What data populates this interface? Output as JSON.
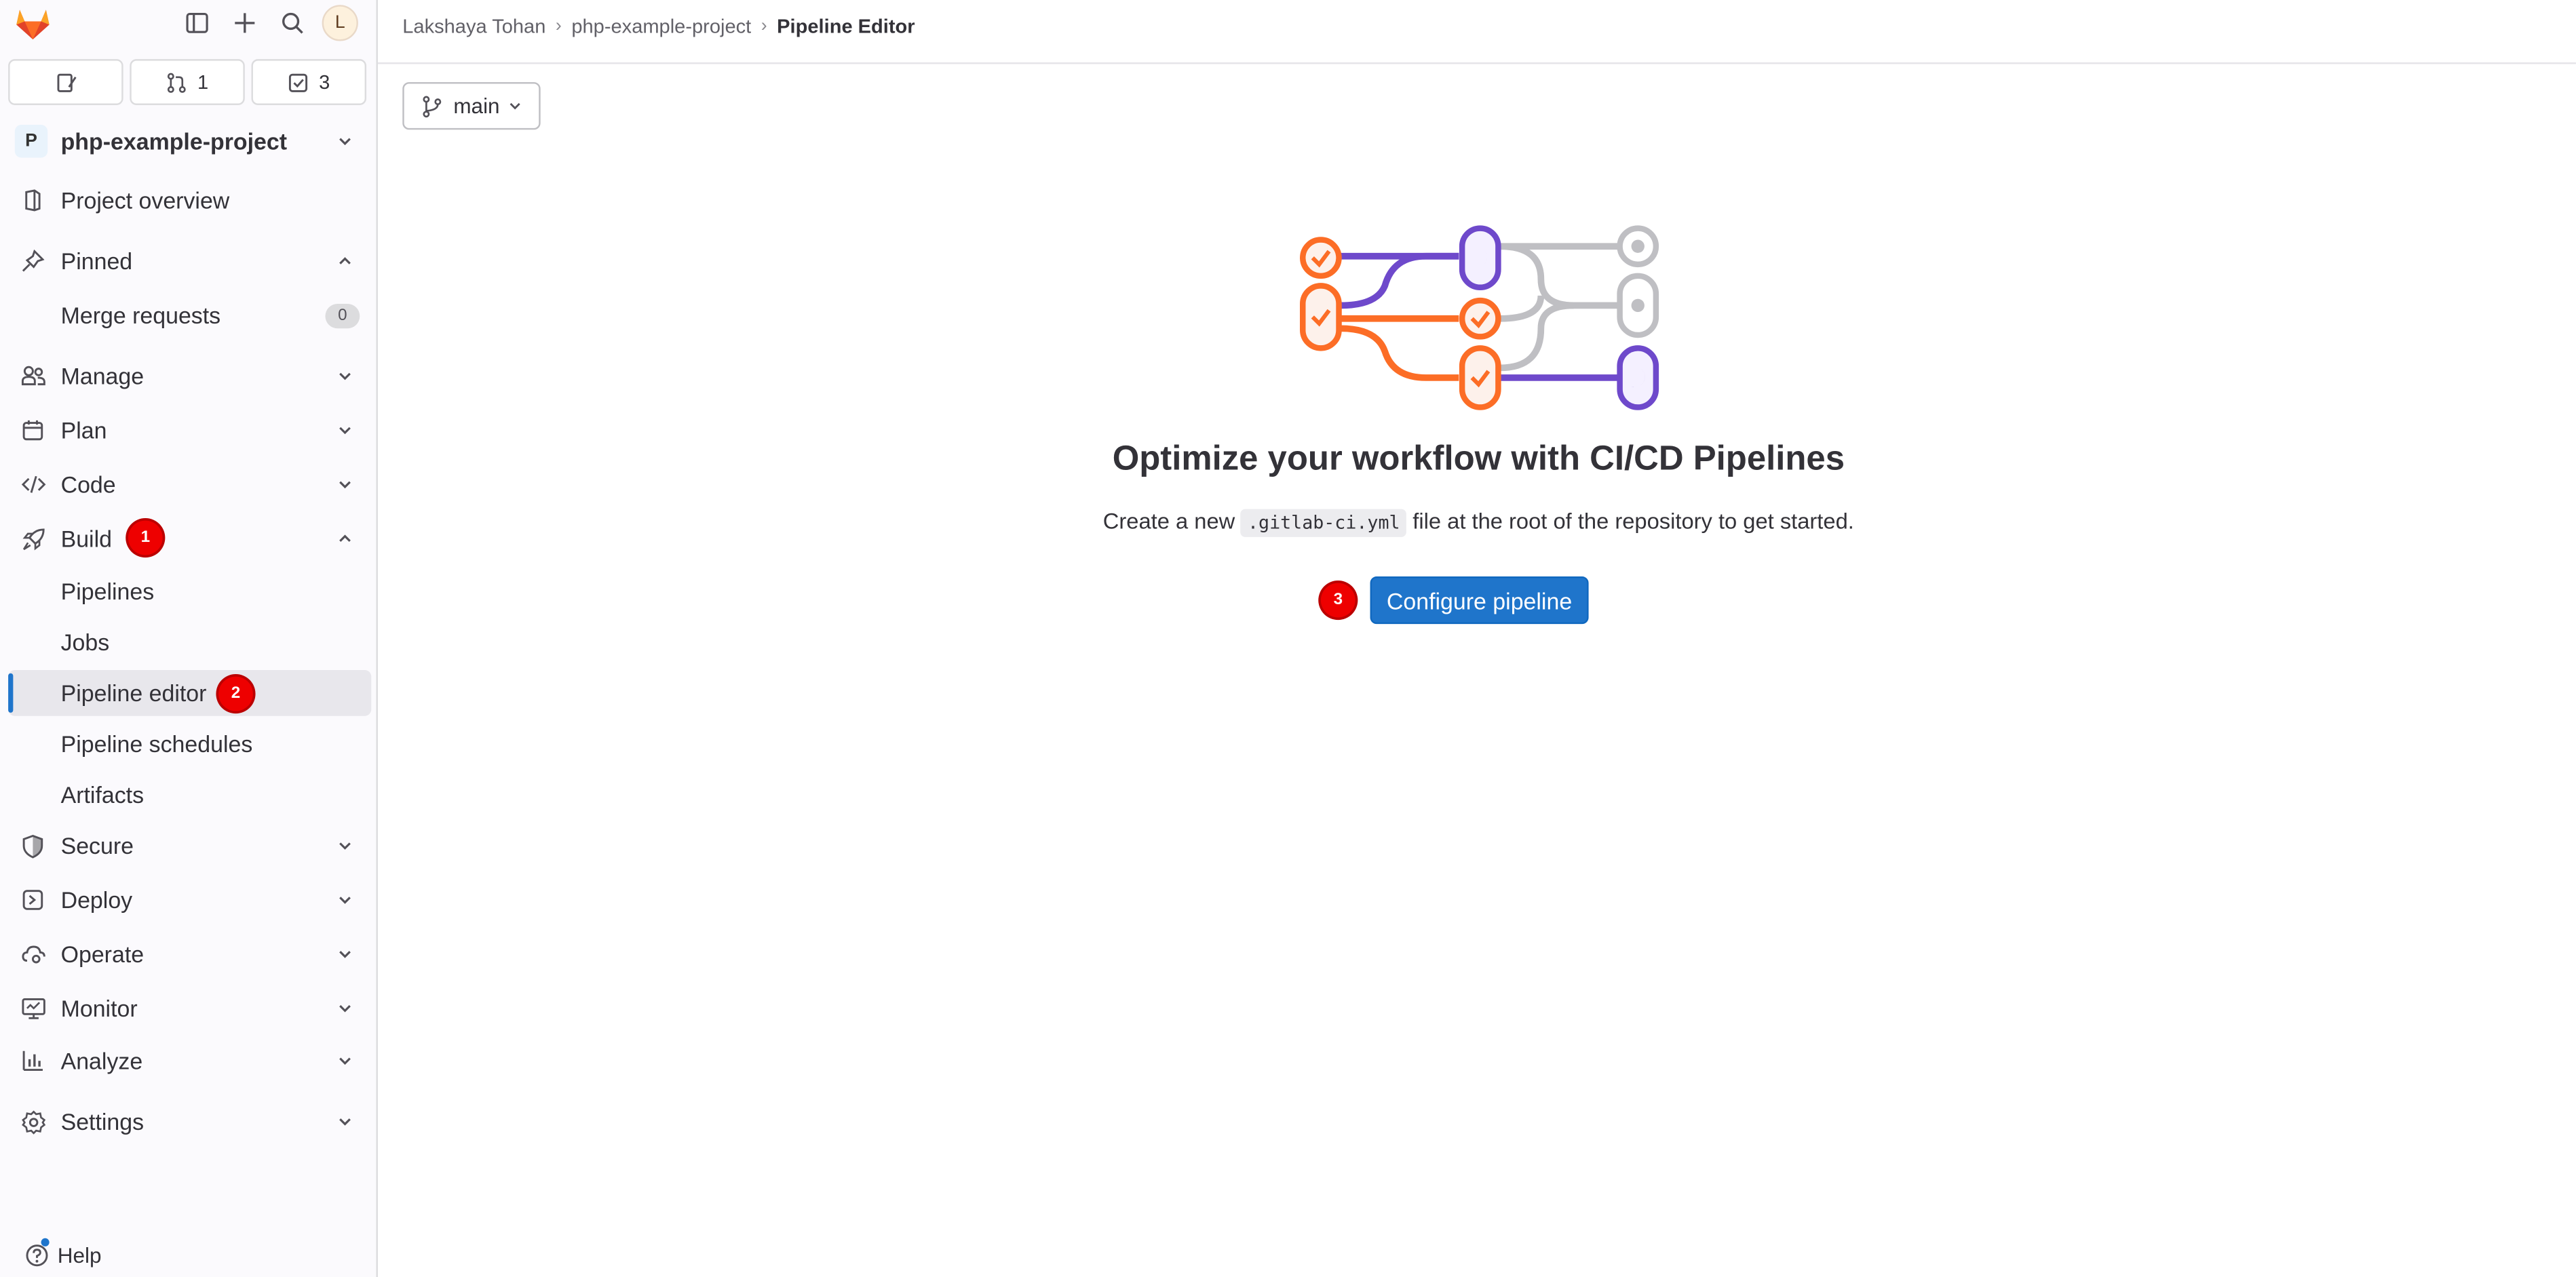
{
  "topbar": {
    "avatar_initial": "L"
  },
  "counts": {
    "merge_requests": "1",
    "todos": "3"
  },
  "project": {
    "initial": "P",
    "name": "php-example-project"
  },
  "nav": {
    "project_overview": "Project overview",
    "pinned": "Pinned",
    "merge_requests": "Merge requests",
    "merge_requests_count": "0",
    "manage": "Manage",
    "plan": "Plan",
    "code": "Code",
    "build": "Build",
    "build_children": {
      "pipelines": "Pipelines",
      "jobs": "Jobs",
      "pipeline_editor": "Pipeline editor",
      "pipeline_schedules": "Pipeline schedules",
      "artifacts": "Artifacts"
    },
    "secure": "Secure",
    "deploy": "Deploy",
    "operate": "Operate",
    "monitor": "Monitor",
    "analyze": "Analyze",
    "settings": "Settings"
  },
  "help": "Help",
  "badges": {
    "build": "1",
    "pipeline_editor": "2",
    "configure": "3"
  },
  "breadcrumbs": {
    "owner": "Lakshaya Tohan",
    "project": "php-example-project",
    "current": "Pipeline Editor"
  },
  "branch": "main",
  "empty_state": {
    "title": "Optimize your workflow with CI/CD Pipelines",
    "desc_before": "Create a new ",
    "desc_code": ".gitlab-ci.yml",
    "desc_after": " file at the root of the repository to get started.",
    "button": "Configure pipeline"
  },
  "colors": {
    "accent": "#1f75cb",
    "orange": "#fc6d26",
    "purple": "#6e49cb",
    "badge_red": "#ee0000"
  }
}
